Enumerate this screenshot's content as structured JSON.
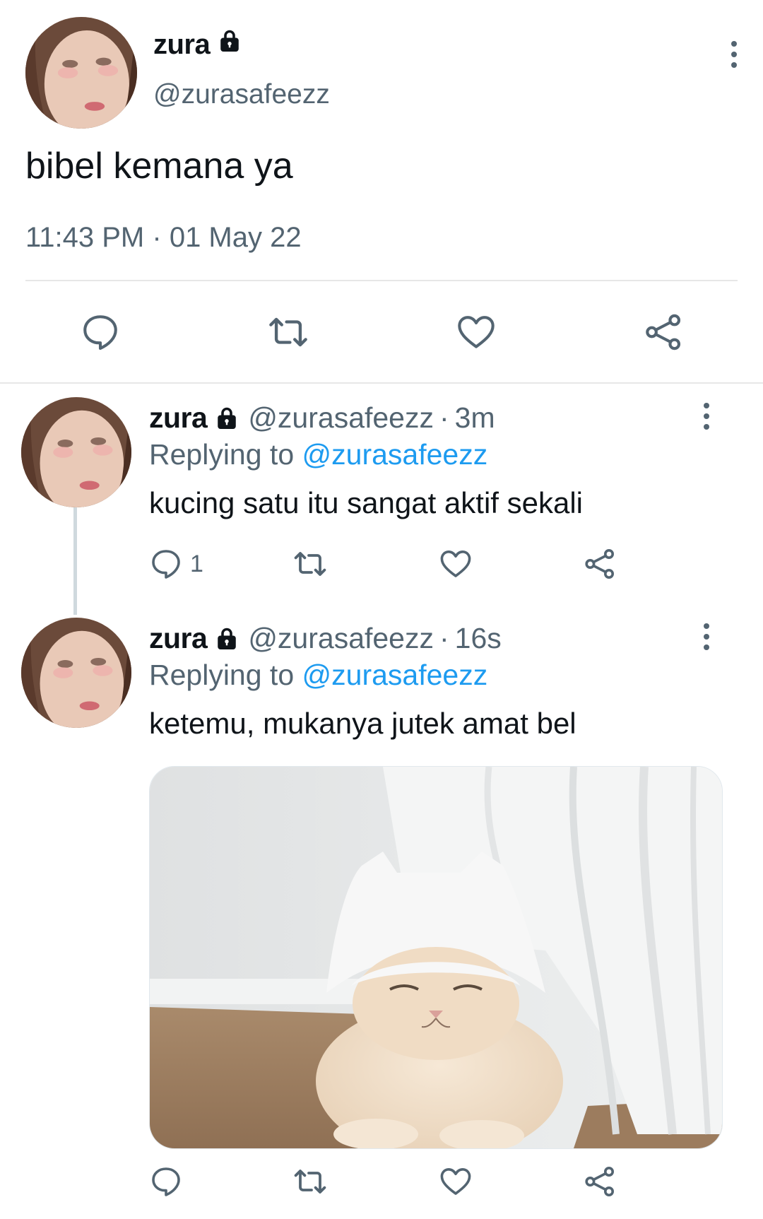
{
  "main_tweet": {
    "display_name": "zura",
    "handle": "@zurasafeezz",
    "text": "bibel kemana ya",
    "time": "11:43 PM",
    "separator": "·",
    "date": "01 May 22",
    "actions": [
      "reply-icon",
      "retweet-icon",
      "like-icon",
      "share-icon"
    ]
  },
  "replies": [
    {
      "display_name": "zura",
      "handle": "@zurasafeezz",
      "separator": "·",
      "time": "3m",
      "replying_prefix": "Replying to",
      "replying_to": "@zurasafeezz",
      "text": "kucing satu itu sangat aktif sekali",
      "reply_count": "1"
    },
    {
      "display_name": "zura",
      "handle": "@zurasafeezz",
      "separator": "·",
      "time": "16s",
      "replying_prefix": "Replying to",
      "replying_to": "@zurasafeezz",
      "text": "ketemu, mukanya jutek amat bel",
      "reply_count": ""
    }
  ],
  "colors": {
    "text": "#0f1419",
    "secondary": "#536471",
    "link": "#1d9bf0",
    "divider": "#e7e7e7"
  }
}
